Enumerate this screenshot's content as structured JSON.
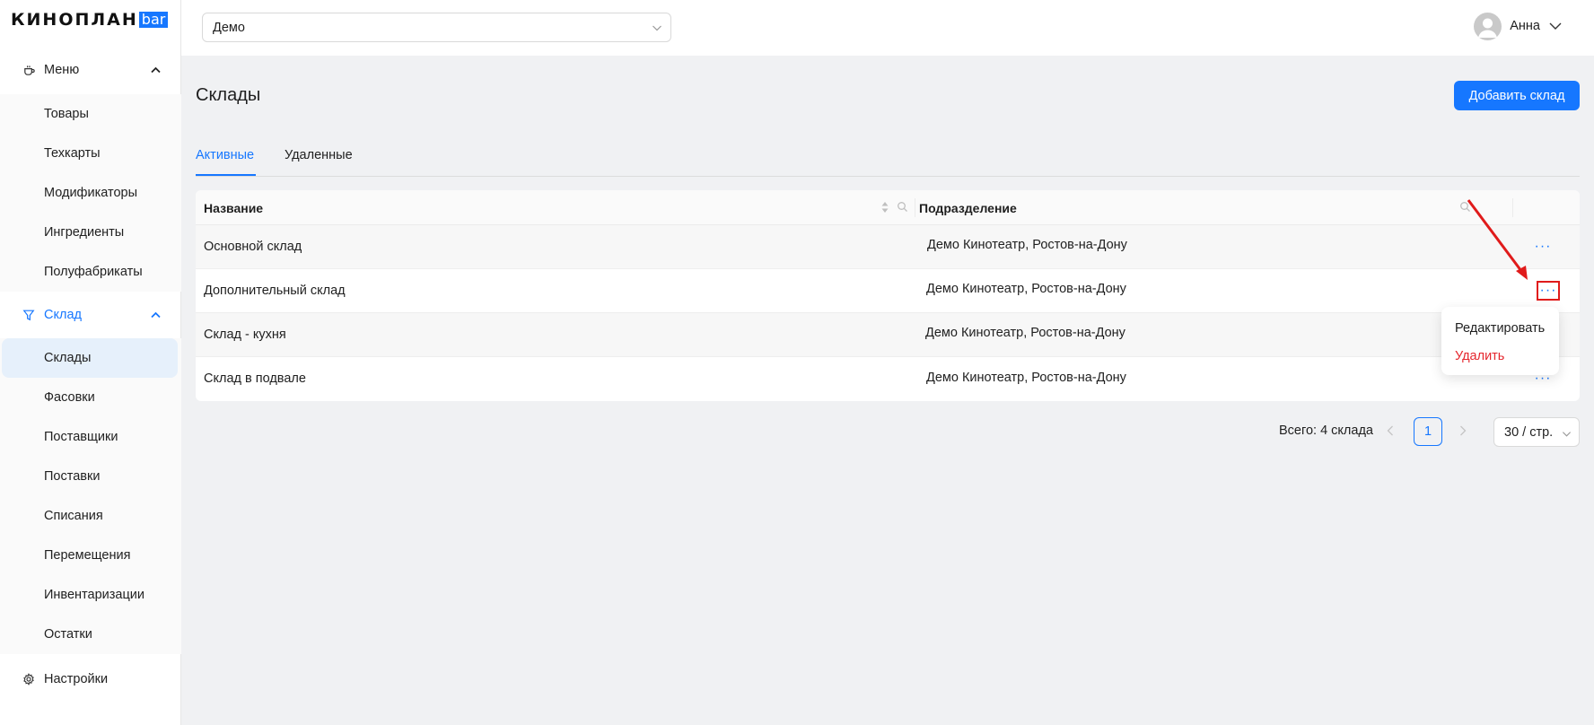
{
  "logo": {
    "text": "КИНОПЛАН",
    "badge": "bar"
  },
  "sidebar": {
    "menu_group": {
      "label": "Меню",
      "icon": "coffee-cup-icon"
    },
    "menu_items": [
      {
        "label": "Товары"
      },
      {
        "label": "Техкарты"
      },
      {
        "label": "Модификаторы"
      },
      {
        "label": "Ингредиенты"
      },
      {
        "label": "Полуфабрикаты"
      }
    ],
    "warehouse_group": {
      "label": "Склад",
      "icon": "funnel-icon"
    },
    "warehouse_items": [
      {
        "label": "Склады",
        "selected": true
      },
      {
        "label": "Фасовки"
      },
      {
        "label": "Поставщики"
      },
      {
        "label": "Поставки"
      },
      {
        "label": "Списания"
      },
      {
        "label": "Перемещения"
      },
      {
        "label": "Инвентаризации"
      },
      {
        "label": "Остатки"
      }
    ],
    "settings": {
      "label": "Настройки",
      "icon": "gear-icon"
    }
  },
  "topbar": {
    "cinema_select": {
      "value": "Демо"
    },
    "user": {
      "name": "Анна",
      "icon": "user-avatar-icon"
    }
  },
  "page": {
    "title": "Склады",
    "add_button": "Добавить склад",
    "tabs": [
      {
        "label": "Активные",
        "active": true
      },
      {
        "label": "Удаленные",
        "active": false
      }
    ]
  },
  "table": {
    "columns": [
      "Название",
      "Подразделение"
    ],
    "rows": [
      {
        "name": "Основной склад",
        "division": "Демо Кинотеатр, Ростов-на-Дону"
      },
      {
        "name": "Дополнительный склад",
        "division": "Демо Кинотеатр, Ростов-на-Дону"
      },
      {
        "name": "Склад - кухня",
        "division": "Демо Кинотеатр, Ростов-на-Дону"
      },
      {
        "name": "Склад в подвале",
        "division": "Демо Кинотеатр, Ростов-на-Дону"
      }
    ],
    "more_label": "···"
  },
  "dropdown": {
    "edit": "Редактировать",
    "delete": "Удалить"
  },
  "pagination": {
    "total": "Всего: 4 склада",
    "current_page": "1",
    "page_size": "30 / стр."
  },
  "colors": {
    "accent": "#1677ff",
    "danger": "#e5262d",
    "annotation": "#e01b1b"
  }
}
